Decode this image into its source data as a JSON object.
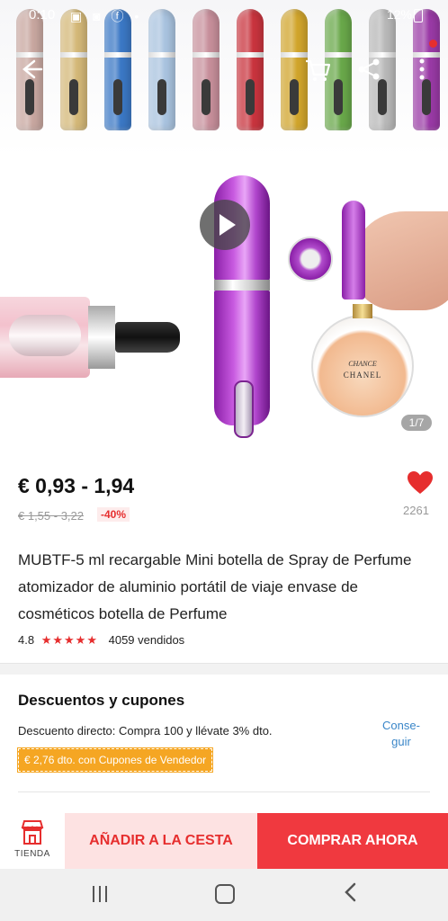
{
  "status_bar": {
    "time": "0:10",
    "battery": "12%"
  },
  "hero": {
    "image_counter": "1/7",
    "bottle_colors": [
      "#c8a7a0",
      "#d4b878",
      "#3b78c5",
      "#a9c3df",
      "#c78f9b",
      "#c9343e",
      "#d1a52c",
      "#69a84a",
      "#b8b8b8",
      "#9a3aa6"
    ],
    "perfume_label_line1": "CHANCE",
    "perfume_label_line2": "CHANEL"
  },
  "product": {
    "price": "€ 0,93 - 1,94",
    "original_price": "€ 1,55 - 3,22",
    "discount": "-40%",
    "wishlist_count": "2261",
    "title": "MUBTF-5 ml recargable Mini botella de Spray de Perfume atomizador de aluminio portátil de viaje envase de cosméticos botella de Perfume",
    "rating": "4.8",
    "stars": "★★★★★",
    "sold": "4059 vendidos"
  },
  "discounts": {
    "title": "Descuentos y cupones",
    "direct": "Descuento directo: Compra 100 y llévate 3% dto.",
    "coupon": "€ 2,76 dto. con Cupones de Vendedor",
    "action": "Conse-guir"
  },
  "actions": {
    "store_label": "TIENDA",
    "add_to_cart": "AÑADIR A LA CESTA",
    "buy_now": "COMPRAR AHORA"
  },
  "colors": {
    "accent": "#e62e2e",
    "buy": "#f0393f",
    "cart_bg": "#fde2e2",
    "coupon": "#f5a623",
    "link": "#3a86c8"
  }
}
